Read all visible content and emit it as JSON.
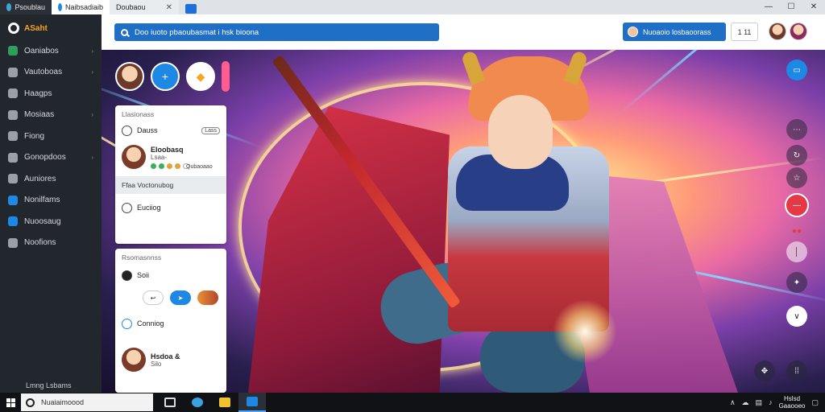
{
  "browser": {
    "tabs": [
      {
        "label": "Psoublau"
      },
      {
        "label": "Naibsadiaib"
      },
      {
        "label": "Doubaou",
        "close": "✕"
      }
    ],
    "window_controls": [
      "—",
      "☐",
      "✕"
    ]
  },
  "sidebar": {
    "brand": "ASaht",
    "items": [
      {
        "label": "Oaniabos",
        "icon": "grid-icon",
        "color": "#2e9e5b",
        "has_chevron": true
      },
      {
        "label": "Vautoboas",
        "icon": "users-icon",
        "color": "#9aa0a6",
        "has_chevron": true
      },
      {
        "label": "Haagps",
        "icon": "layers-icon",
        "color": "#9aa0a6",
        "has_chevron": false
      },
      {
        "label": "Mosiaas",
        "icon": "media-icon",
        "color": "#9aa0a6",
        "has_chevron": true
      },
      {
        "label": "Fiong",
        "icon": "chart-icon",
        "color": "#9aa0a6",
        "has_chevron": false
      },
      {
        "label": "Gonopdoos",
        "icon": "share-icon",
        "color": "#9aa0a6",
        "has_chevron": true
      },
      {
        "label": "Auniores",
        "icon": "person-icon",
        "color": "#9aa0a6",
        "has_chevron": false
      },
      {
        "label": "Nonilfams",
        "icon": "globe-icon",
        "color": "#1e88e5",
        "has_chevron": false
      },
      {
        "label": "Nuoosaug",
        "icon": "shield-icon",
        "color": "#1e88e5",
        "has_chevron": false
      },
      {
        "label": "Noofions",
        "icon": "bell-icon",
        "color": "#9aa0a6",
        "has_chevron": false
      }
    ],
    "footer": "Lmng Lsbams"
  },
  "topbar": {
    "search_text": "Doo iuoto pbaoubasmat i hsk bioona",
    "user_label": "Nuoaoio  losbaoorass",
    "ctrl_label": "1 11"
  },
  "panel": {
    "card1": {
      "title": "Llasionass",
      "row1": {
        "label": "Dauss",
        "badge": "Lass"
      },
      "row2": {
        "name": "Eloobasq",
        "sub": "Lsaa-",
        "chip": "Qubaoaao",
        "dots": [
          "#3fae5a",
          "#3fae5a",
          "#e3a13a",
          "#e3a13a"
        ]
      },
      "gray": "Ffaa Voctonubog",
      "row3": {
        "label": "Euciiog"
      }
    },
    "card2": {
      "title": "Rsomasnnss",
      "row1": {
        "label": "Soii"
      },
      "row2": {
        "label": "Conniog"
      },
      "row3": {
        "name": "Hsdoa &",
        "sub": "Silo"
      }
    }
  },
  "taskbar": {
    "search_placeholder": "Nuaiaimoood",
    "time": "Hslsd",
    "date": "Gaaooeo"
  }
}
